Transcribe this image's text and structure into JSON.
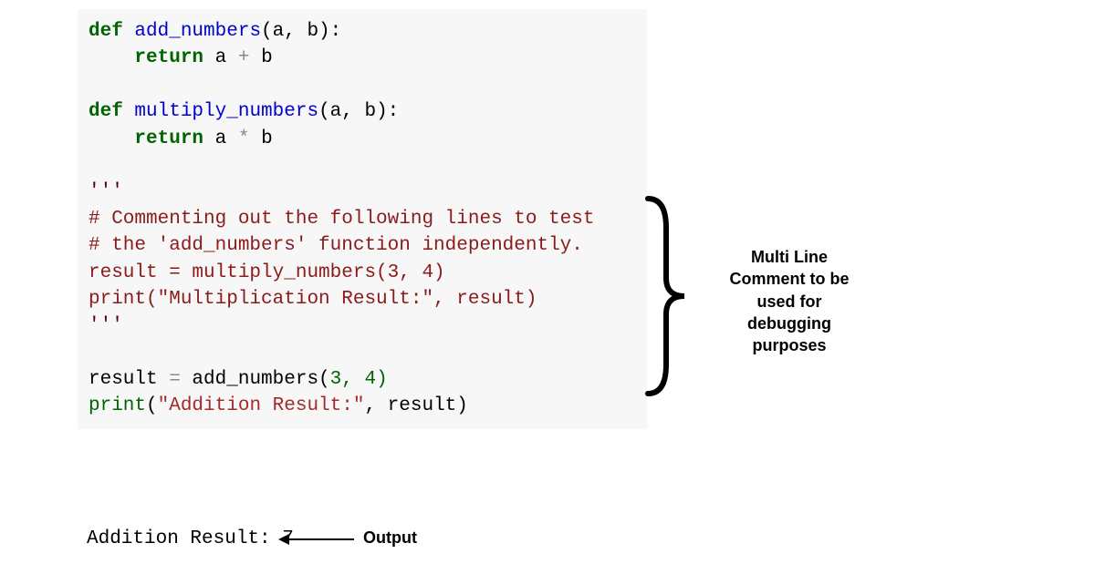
{
  "code": {
    "def": "def",
    "ret": "return",
    "fn_add": "add_numbers",
    "fn_mul": "multiply_numbers",
    "params": "(a, b):",
    "return_add": " a ",
    "plus": "+",
    "b_after": " b",
    "return_mul": " a ",
    "star": "*",
    "triple1": "'''",
    "cmt1": "# Commenting out the following lines to test",
    "cmt2": "# the 'add_numbers' function independently.",
    "assign1": "result = multiply_numbers(3, 4)",
    "print1": "print(\"Multiplication Result:\", result)",
    "triple2": "'''",
    "result_eq": "result ",
    "equals": "=",
    "call_add": " add_numbers(",
    "args_add": "3, 4)",
    "print_kw": "print",
    "print_open": "(",
    "str_add": "\"Addition Result:\"",
    "after_str": ", result)"
  },
  "output": {
    "text": "Addition Result: 7",
    "label": "Output"
  },
  "annotation": {
    "line1": "Multi Line",
    "line2": "Comment to be",
    "line3": "used for",
    "line4": "debugging",
    "line5": "purposes"
  }
}
